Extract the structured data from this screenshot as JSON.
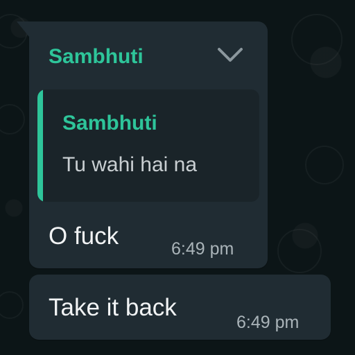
{
  "colors": {
    "bubble": "#202c33",
    "quote_background": "#1a2429",
    "accent_green": "#2ec59a",
    "message_text": "#f1f3f4",
    "timestamp_text": "#aab4b9",
    "chat_background": "#0c1517"
  },
  "messages": [
    {
      "sender": "Sambhuti",
      "menu_icon": "chevron-down-icon",
      "quoted": {
        "sender": "Sambhuti",
        "text": "Tu wahi hai na"
      },
      "text": "O fuck",
      "time": "6:49 pm"
    },
    {
      "text": "Take it back",
      "time": "6:49 pm"
    }
  ]
}
